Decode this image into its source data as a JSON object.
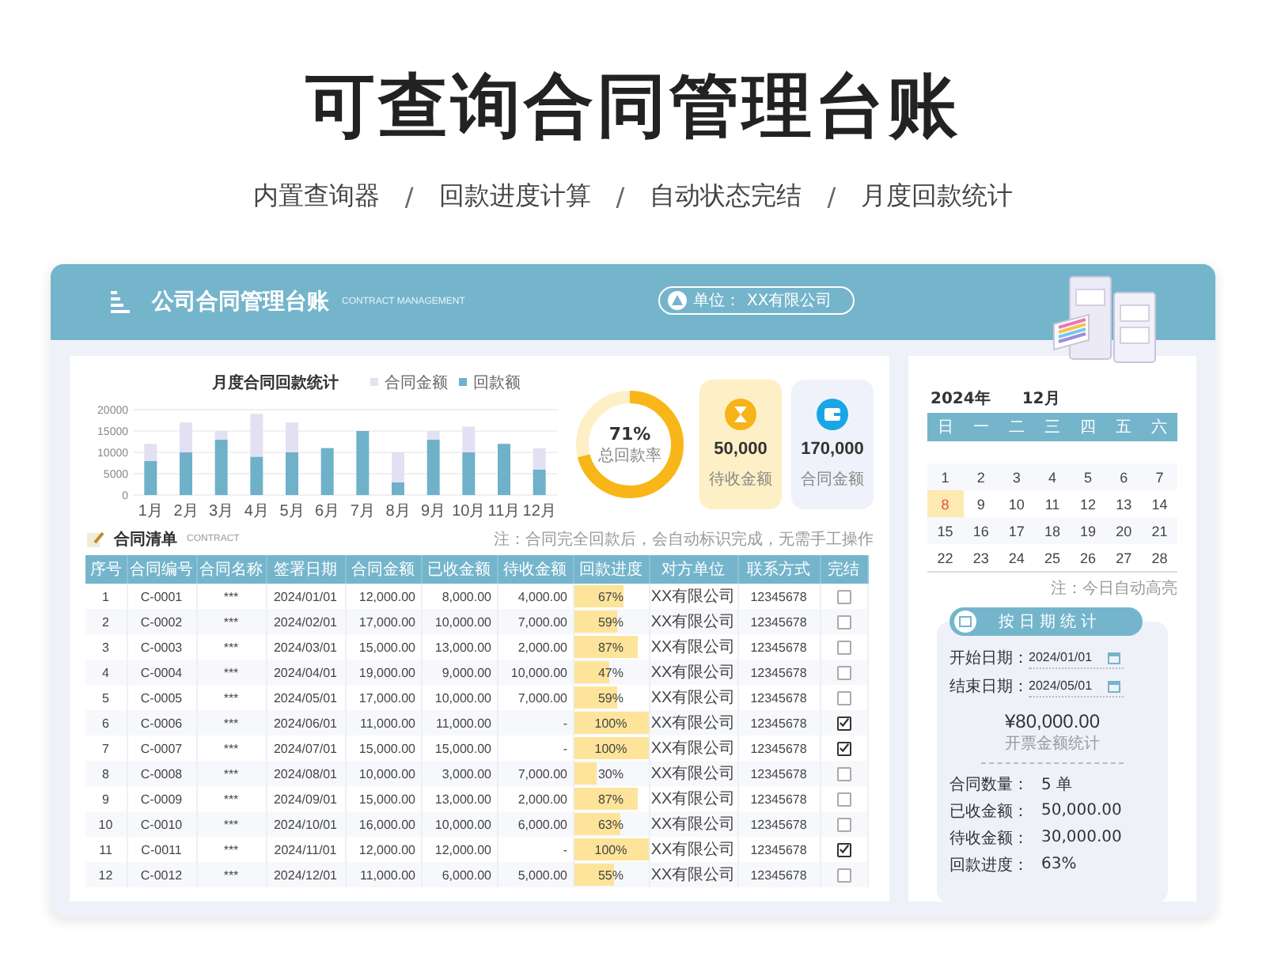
{
  "page_title": "可查询合同管理台账",
  "features": {
    "separator": "/",
    "items": [
      "内置查询器",
      "回款进度计算",
      "自动状态完结",
      "月度回款统计"
    ]
  },
  "header": {
    "title": "公司合同管理台账",
    "subtitle": "CONTRACT MANAGEMENT",
    "unit_label": "单位：",
    "unit_value": "XX有限公司"
  },
  "chart": {
    "chart_data": {
      "type": "bar",
      "title": "月度合同回款统计",
      "categories": [
        "1月",
        "2月",
        "3月",
        "4月",
        "5月",
        "6月",
        "7月",
        "8月",
        "9月",
        "10月",
        "11月",
        "12月"
      ],
      "series": [
        {
          "name": "回款额",
          "color": "#6fb1c9",
          "values": [
            8000,
            10000,
            13000,
            9000,
            10000,
            11000,
            15000,
            3000,
            13000,
            10000,
            12000,
            6000
          ]
        },
        {
          "name": "合同金额",
          "color": "#e2e1f3",
          "values": [
            4000,
            7000,
            2000,
            10000,
            7000,
            0,
            0,
            7000,
            2000,
            6000,
            0,
            5000
          ]
        }
      ],
      "stacked": true,
      "grid": true,
      "legend": "top-right",
      "ylim": [
        0,
        20000
      ],
      "yticks": [
        0,
        5000,
        10000,
        15000,
        20000
      ]
    }
  },
  "rate": {
    "level": 0.71,
    "value": "71%",
    "label": "总回款率"
  },
  "summary_cards": [
    {
      "kind": "pending",
      "value": "50,000",
      "label": "待收金额"
    },
    {
      "kind": "total",
      "value": "170,000",
      "label": "合同金额"
    }
  ],
  "contract_list": {
    "title": "合同清单",
    "subtitle": "CONTRACT",
    "note": "注：合同完全回款后，会自动标识完成，无需手工操作",
    "columns": [
      "序号",
      "合同编号",
      "合同名称",
      "签署日期",
      "合同金额",
      "已收金额",
      "待收金额",
      "回款进度",
      "对方单位",
      "联系方式",
      "完结"
    ],
    "rows": [
      {
        "no": "1",
        "code": "C-0001",
        "name": "***",
        "date": "2024/01/01",
        "amount": "12,000.00",
        "received": "8,000.00",
        "pending": "4,000.00",
        "level": 0.67,
        "progress": "67%",
        "party": "XX有限公司",
        "phone": "12345678",
        "checked": false
      },
      {
        "no": "2",
        "code": "C-0002",
        "name": "***",
        "date": "2024/02/01",
        "amount": "17,000.00",
        "received": "10,000.00",
        "pending": "7,000.00",
        "level": 0.59,
        "progress": "59%",
        "party": "XX有限公司",
        "phone": "12345678",
        "checked": false
      },
      {
        "no": "3",
        "code": "C-0003",
        "name": "***",
        "date": "2024/03/01",
        "amount": "15,000.00",
        "received": "13,000.00",
        "pending": "2,000.00",
        "level": 0.87,
        "progress": "87%",
        "party": "XX有限公司",
        "phone": "12345678",
        "checked": false
      },
      {
        "no": "4",
        "code": "C-0004",
        "name": "***",
        "date": "2024/04/01",
        "amount": "19,000.00",
        "received": "9,000.00",
        "pending": "10,000.00",
        "level": 0.47,
        "progress": "47%",
        "party": "XX有限公司",
        "phone": "12345678",
        "checked": false
      },
      {
        "no": "5",
        "code": "C-0005",
        "name": "***",
        "date": "2024/05/01",
        "amount": "17,000.00",
        "received": "10,000.00",
        "pending": "7,000.00",
        "level": 0.59,
        "progress": "59%",
        "party": "XX有限公司",
        "phone": "12345678",
        "checked": false
      },
      {
        "no": "6",
        "code": "C-0006",
        "name": "***",
        "date": "2024/06/01",
        "amount": "11,000.00",
        "received": "11,000.00",
        "pending": "-",
        "level": 1,
        "progress": "100%",
        "party": "XX有限公司",
        "phone": "12345678",
        "checked": true
      },
      {
        "no": "7",
        "code": "C-0007",
        "name": "***",
        "date": "2024/07/01",
        "amount": "15,000.00",
        "received": "15,000.00",
        "pending": "-",
        "level": 1,
        "progress": "100%",
        "party": "XX有限公司",
        "phone": "12345678",
        "checked": true
      },
      {
        "no": "8",
        "code": "C-0008",
        "name": "***",
        "date": "2024/08/01",
        "amount": "10,000.00",
        "received": "3,000.00",
        "pending": "7,000.00",
        "level": 0.3,
        "progress": "30%",
        "party": "XX有限公司",
        "phone": "12345678",
        "checked": false
      },
      {
        "no": "9",
        "code": "C-0009",
        "name": "***",
        "date": "2024/09/01",
        "amount": "15,000.00",
        "received": "13,000.00",
        "pending": "2,000.00",
        "level": 0.87,
        "progress": "87%",
        "party": "XX有限公司",
        "phone": "12345678",
        "checked": false
      },
      {
        "no": "10",
        "code": "C-0010",
        "name": "***",
        "date": "2024/10/01",
        "amount": "16,000.00",
        "received": "10,000.00",
        "pending": "6,000.00",
        "level": 0.63,
        "progress": "63%",
        "party": "XX有限公司",
        "phone": "12345678",
        "checked": false
      },
      {
        "no": "11",
        "code": "C-0011",
        "name": "***",
        "date": "2024/11/01",
        "amount": "12,000.00",
        "received": "12,000.00",
        "pending": "-",
        "level": 1,
        "progress": "100%",
        "party": "XX有限公司",
        "phone": "12345678",
        "checked": true
      },
      {
        "no": "12",
        "code": "C-0012",
        "name": "***",
        "date": "2024/12/01",
        "amount": "11,000.00",
        "received": "6,000.00",
        "pending": "5,000.00",
        "level": 0.55,
        "progress": "55%",
        "party": "XX有限公司",
        "phone": "12345678",
        "checked": false
      }
    ]
  },
  "calendar": {
    "year": "2024年",
    "month": "12月",
    "weekdays": [
      "日",
      "一",
      "二",
      "三",
      "四",
      "五",
      "六"
    ],
    "days": [
      {
        "label": "1",
        "today": false
      },
      {
        "label": "2",
        "today": false
      },
      {
        "label": "3",
        "today": false
      },
      {
        "label": "4",
        "today": false
      },
      {
        "label": "5",
        "today": false
      },
      {
        "label": "6",
        "today": false
      },
      {
        "label": "7",
        "today": false
      },
      {
        "label": "8",
        "today": true
      },
      {
        "label": "9",
        "today": false
      },
      {
        "label": "10",
        "today": false
      },
      {
        "label": "11",
        "today": false
      },
      {
        "label": "12",
        "today": false
      },
      {
        "label": "13",
        "today": false
      },
      {
        "label": "14",
        "today": false
      },
      {
        "label": "15",
        "today": false
      },
      {
        "label": "16",
        "today": false
      },
      {
        "label": "17",
        "today": false
      },
      {
        "label": "18",
        "today": false
      },
      {
        "label": "19",
        "today": false
      },
      {
        "label": "20",
        "today": false
      },
      {
        "label": "21",
        "today": false
      },
      {
        "label": "22",
        "today": false
      },
      {
        "label": "23",
        "today": false
      },
      {
        "label": "24",
        "today": false
      },
      {
        "label": "25",
        "today": false
      },
      {
        "label": "26",
        "today": false
      },
      {
        "label": "27",
        "today": false
      },
      {
        "label": "28",
        "today": false
      }
    ],
    "note": "注：今日自动高亮"
  },
  "date_stats": {
    "title": "按日期统计",
    "fields": [
      {
        "label": "开始日期：",
        "value": "2024/01/01"
      },
      {
        "label": "结束日期：",
        "value": "2024/05/01"
      }
    ],
    "amount": "¥80,000.00",
    "amount_label": "开票金额统计",
    "rows": [
      {
        "label": "合同数量：",
        "value": "5 单"
      },
      {
        "label": "已收金额：",
        "value": "50,000.00"
      },
      {
        "label": "待收金额：",
        "value": "30,000.00"
      },
      {
        "label": "回款进度：",
        "value": "63%"
      }
    ]
  }
}
